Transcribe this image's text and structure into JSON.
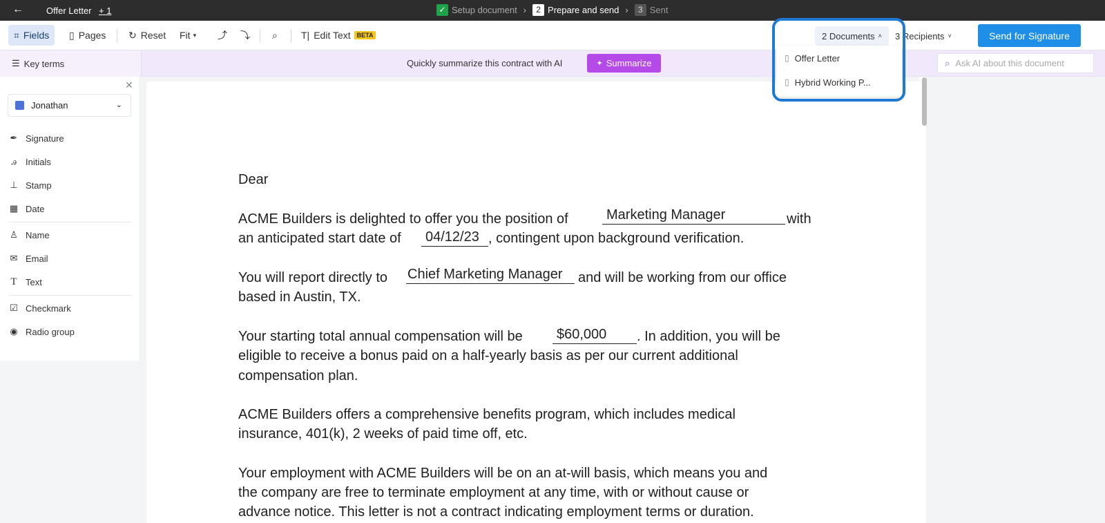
{
  "topbar": {
    "back_icon": "arrow-left-icon",
    "title": "Offer Letter",
    "extra": "+ 1",
    "steps": [
      {
        "num": "✓",
        "label": "Setup document"
      },
      {
        "num": "2",
        "label": "Prepare and send"
      },
      {
        "num": "3",
        "label": "Sent"
      }
    ]
  },
  "toolbar": {
    "fields": "Fields",
    "pages": "Pages",
    "reset": "Reset",
    "fit": "Fit",
    "edit_text": "Edit Text",
    "beta": "BETA",
    "documents": "2 Documents",
    "recipients": "3 Recipients",
    "send": "Send for Signature"
  },
  "banner": {
    "key_terms": "Key terms",
    "text": "Quickly summarize this contract with AI",
    "summarize": "Summarize",
    "ask_placeholder": "Ask AI about this document"
  },
  "sidebar": {
    "recipient": "Jonathan",
    "recipient_color": "#4a72d9",
    "fields": [
      {
        "label": "Signature",
        "icon": "pen-icon"
      },
      {
        "label": "Initials",
        "icon": "initials-icon"
      },
      {
        "label": "Stamp",
        "icon": "stamp-icon"
      },
      {
        "label": "Date",
        "icon": "calendar-icon"
      },
      {
        "label": "Name",
        "icon": "person-icon"
      },
      {
        "label": "Email",
        "icon": "mail-icon"
      },
      {
        "label": "Text",
        "icon": "text-icon"
      },
      {
        "label": "Checkmark",
        "icon": "checkbox-icon"
      },
      {
        "label": "Radio group",
        "icon": "radio-icon"
      }
    ]
  },
  "dropdown": {
    "items": [
      "Offer Letter",
      "Hybrid Working P..."
    ]
  },
  "document": {
    "dear": "Dear",
    "p1_a": "ACME Builders is delighted to offer you the position of",
    "position": "Marketing Manager",
    "p1_b": "with",
    "p1_c": "an anticipated start date of",
    "start_date": "04/12/23",
    "p1_d": ", contingent upon background verification.",
    "p2_a": "You will report directly to",
    "manager": "Chief Marketing Manager",
    "p2_b": "and will be working from our office",
    "p2_c": "based in Austin, TX.",
    "p3_a": "Your starting total annual compensation will be",
    "salary": "$60,000",
    "p3_b": ". In addition, you will be",
    "p3_c": "eligible to receive a bonus paid on a half-yearly basis as per our current additional",
    "p3_d": "compensation plan.",
    "p4_a": "ACME Builders offers a comprehensive benefits program, which includes medical",
    "p4_b": "insurance, 401(k), 2 weeks of paid time off, etc.",
    "p5_a": "Your employment with ACME Builders will be on an at-will basis, which means you and",
    "p5_b": "the company are free to terminate employment at any time, with or without cause or",
    "p5_c": "advance notice. This letter is not a contract indicating employment terms or duration."
  },
  "colors": {
    "accent": "#1e8ee6",
    "summarize": "#b54ae8",
    "highlight": "#1f78d1"
  }
}
